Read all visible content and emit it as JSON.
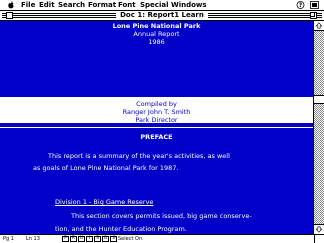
{
  "menubar": {
    "apple_icon": "apple-logo-icon",
    "items": [
      "File",
      "Edit",
      "Search",
      "Format",
      "Font",
      "Special",
      "Windows"
    ],
    "right_icons": [
      "help-icon",
      "application-icon"
    ]
  },
  "window": {
    "title": "Doc 1: Report1 Learn"
  },
  "document": {
    "lines": {
      "org": "Lone Pine National Park",
      "report": "Annual Report",
      "year": "1986",
      "compiled": "Compiled by",
      "author": "Ranger John T. Smith",
      "role": "Park Director",
      "preface": "PREFACE",
      "p1a": "This report is a summary of the year's activities, as well",
      "p1b": "as goals of Lone Pine National Park for 1987.",
      "division": "Division 1 - Big Game Reserve",
      "p2a": "This section covers permits issued, big game conserve-",
      "p2b": "tion, and the Hunter Education Program."
    },
    "background_color": "#0000c8",
    "text_color": "#ffffff"
  },
  "statusbar": {
    "page": "Pg 1",
    "line": "Ln 13",
    "mode_boxes": [
      "P",
      "R",
      "U",
      "I",
      "S",
      "O",
      "S"
    ],
    "mode_active": [
      false,
      false,
      false,
      false,
      false,
      false,
      false
    ],
    "select": "Select On"
  }
}
